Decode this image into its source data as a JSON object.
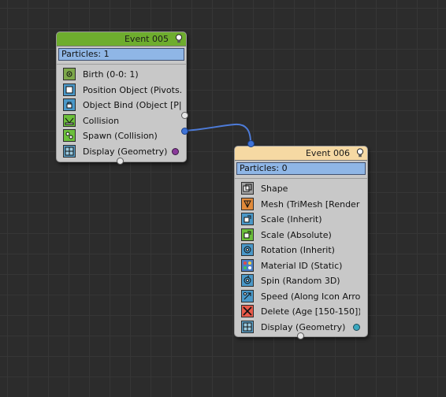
{
  "colors": {
    "background": "#2c2c2c",
    "event_header_active": "#6ead2e",
    "event_header_selected": "#f6d9a3",
    "particles_bar": "#8fb6e6",
    "wire": "#4d7bd8"
  },
  "event_005": {
    "title": "Event  005",
    "particles": "Particles: 1",
    "operators": [
      {
        "label": "Birth (0-0: 1)",
        "icon": "birth-icon",
        "color": "#7da84a"
      },
      {
        "label": "Position Object (Pivots...",
        "icon": "position-object-icon",
        "color": "#4a98c8"
      },
      {
        "label": "Object Bind (Object [P|...",
        "icon": "object-bind-icon",
        "color": "#4a98c8"
      },
      {
        "label": "Collision",
        "icon": "collision-test-icon",
        "color": "#6bbf3b"
      },
      {
        "label": "Spawn (Collision)",
        "icon": "spawn-test-icon",
        "color": "#6bbf3b"
      },
      {
        "label": "Display (Geometry)",
        "icon": "display-icon",
        "color": "#5aa0c8"
      }
    ],
    "display_dot_color": "#8a3a9a"
  },
  "event_006": {
    "title": "Event  006",
    "particles": "Particles: 0",
    "operators": [
      {
        "label": "Shape",
        "icon": "shape-icon",
        "color": "#a0a0a0"
      },
      {
        "label": "Mesh (TriMesh [Render])",
        "icon": "mesh-icon",
        "color": "#e08a3a"
      },
      {
        "label": "Scale (Inherit)",
        "icon": "scale-icon",
        "color": "#4a98c8"
      },
      {
        "label": "Scale (Absolute)",
        "icon": "scale-test-icon",
        "color": "#6bbf3b"
      },
      {
        "label": "Rotation (Inherit)",
        "icon": "rotation-icon",
        "color": "#4a98c8"
      },
      {
        "label": "Material ID (Static)",
        "icon": "material-id-icon",
        "color": "#4a7ec8"
      },
      {
        "label": "Spin (Random 3D)",
        "icon": "spin-icon",
        "color": "#4a98c8"
      },
      {
        "label": "Speed (Along Icon Arro...",
        "icon": "speed-icon",
        "color": "#4a98c8"
      },
      {
        "label": "Delete (Age [150-150])",
        "icon": "delete-icon",
        "color": "#e85a4a"
      },
      {
        "label": "Display (Geometry)",
        "icon": "display-icon",
        "color": "#5aa0c8"
      }
    ],
    "display_dot_color": "#3aa8c0"
  }
}
